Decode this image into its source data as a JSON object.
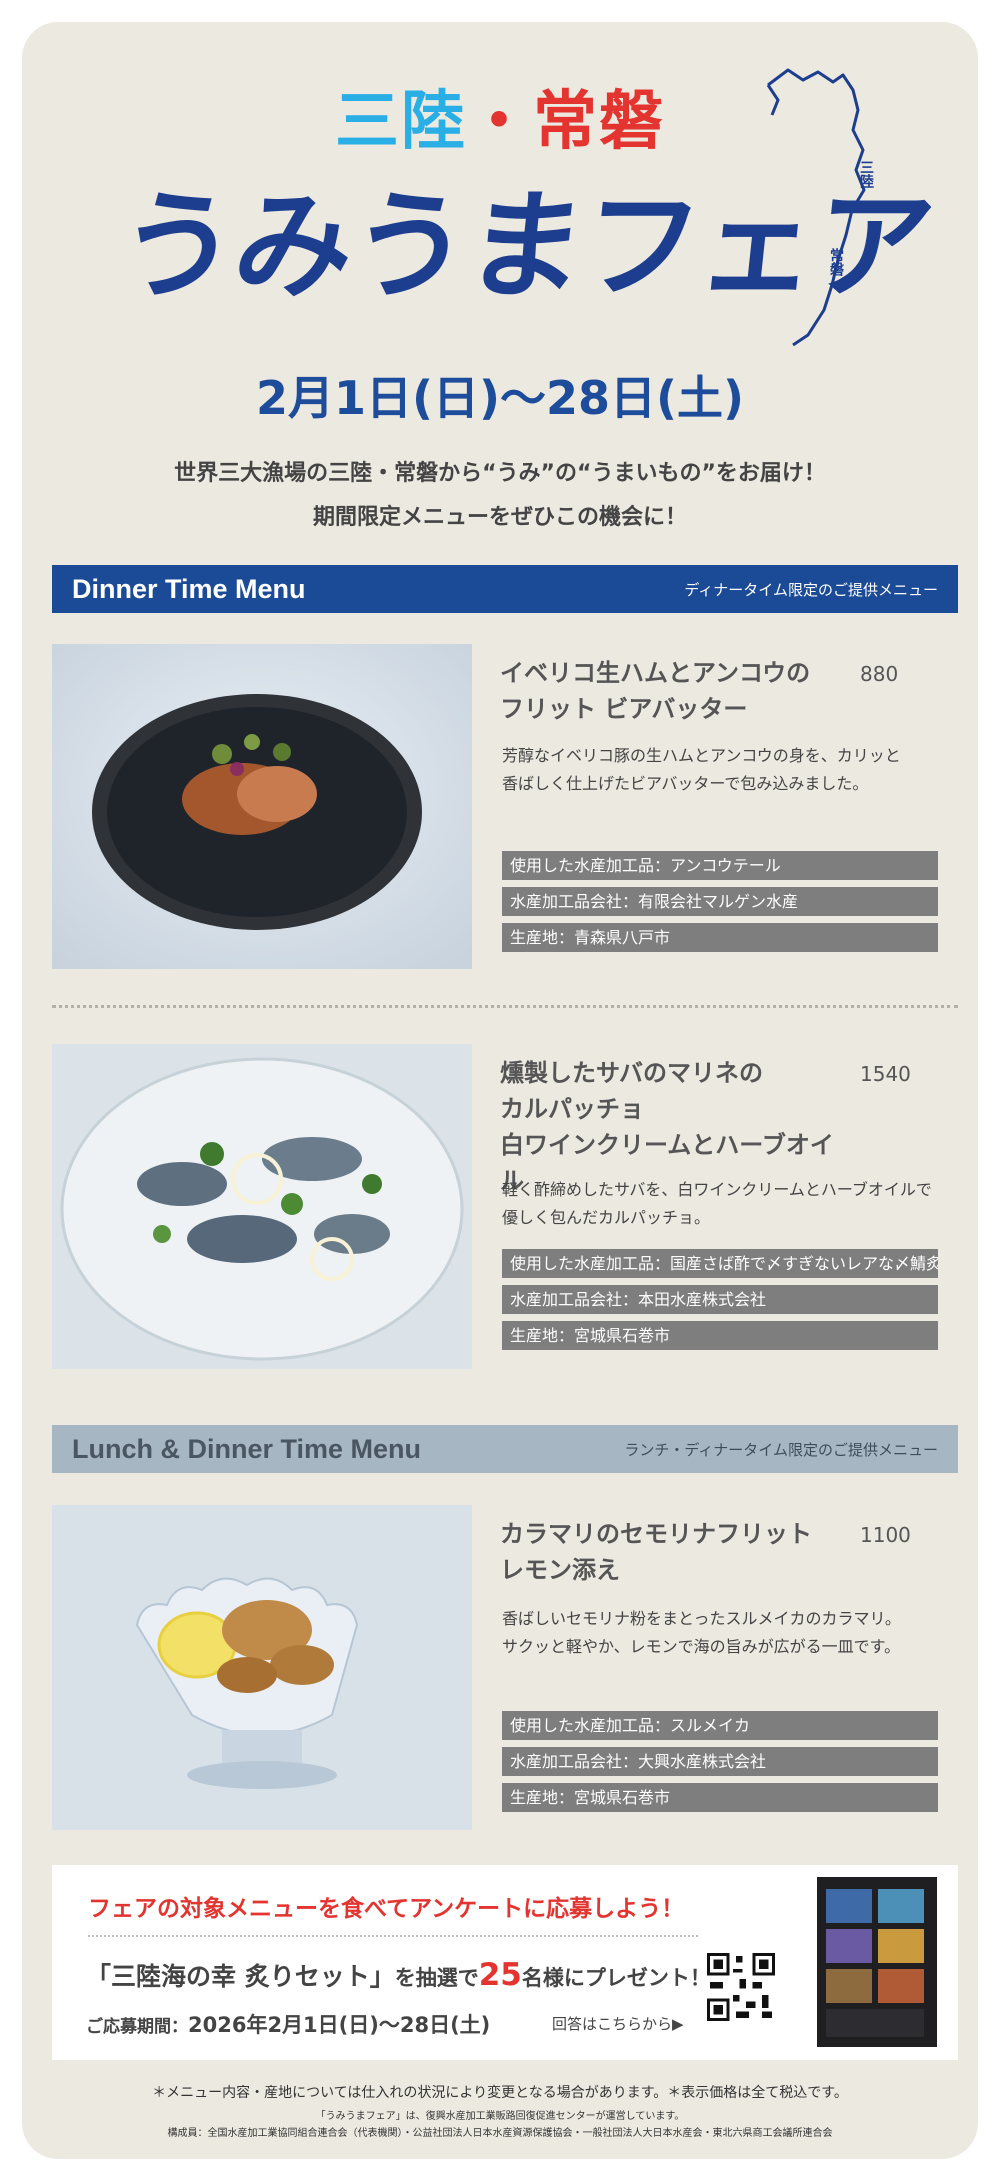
{
  "header": {
    "title_part1": "三陸",
    "title_dot": "・",
    "title_part2": "常磐",
    "logo_main": "うみうまフェア",
    "map_label_sanriku": "三陸",
    "map_label_joban": "常磐",
    "date_range": "2月1日(日)〜28日(土)",
    "intro_line1": "世界三大漁場の三陸・常磐から“うみ”の“うまいもの”をお届け！",
    "intro_line2": "期間限定メニューをぜひこの機会に！"
  },
  "sections": {
    "dinner": {
      "title": "Dinner Time Menu",
      "subtitle": "ディナータイム限定のご提供メニュー"
    },
    "lunch_dinner": {
      "title": "Lunch & Dinner Time Menu",
      "subtitle": "ランチ・ディナータイム限定のご提供メニュー"
    }
  },
  "items": [
    {
      "name_line1": "イベリコ生ハムとアンコウの",
      "name_line2": "フリット ビアバッター",
      "price": "880",
      "desc_line1": "芳醇なイベリコ豚の生ハムとアンコウの身を、カリッと",
      "desc_line2": "香ばしく仕上げたビアバッターで包み込みました。",
      "tags": [
        "使用した水産加工品：アンコウテール",
        "水産加工品会社：有限会社マルゲン水産",
        "生産地：青森県八戸市"
      ]
    },
    {
      "name_line1": "燻製したサバのマリネの",
      "name_line2": "カルパッチョ",
      "name_line3": "白ワインクリームとハーブオイル",
      "price": "1540",
      "desc_line1": "軽く酢締めしたサバを、白ワインクリームとハーブオイルで",
      "desc_line2": "優しく包んだカルパッチョ。",
      "tags": [
        "使用した水産加工品：国産さば酢で〆すぎないレアな〆鯖炙り",
        "水産加工品会社：本田水産株式会社",
        "生産地：宮城県石巻市"
      ]
    },
    {
      "name_line1": "カラマリのセモリナフリット",
      "name_line2": "レモン添え",
      "price": "1100",
      "desc_line1": "香ばしいセモリナ粉をまとったスルメイカのカラマリ。",
      "desc_line2": "サクッと軽やか、レモンで海の旨みが広がる一皿です。",
      "tags": [
        "使用した水産加工品：スルメイカ",
        "水産加工品会社：大興水産株式会社",
        "生産地：宮城県石巻市"
      ]
    }
  ],
  "campaign": {
    "headline": "フェアの対象メニューを食べてアンケートに応募しよう！",
    "prize_name": "「三陸海の幸 炙りセット」",
    "prize_mid": "を抽選で",
    "prize_count": "25",
    "prize_end": "名様にプレゼント！",
    "period_label": "ご応募期間：",
    "period_value": "2026年2月1日(日)〜28日(土)",
    "answer_link": "回答はこちらから▶"
  },
  "footer": {
    "note1": "＊メニュー内容・産地については仕入れの状況により変更となる場合があります。＊表示価格は全て税込です。",
    "note2": "「うみうまフェア」は、復興水産加工業販路回復促進センターが運営しています。",
    "note3": "構成員：全国水産加工業協同組合連合会（代表機関）・公益社団法人日本水産資源保護協会・一般社団法人大日本水産会・東北六県商工会議所連合会"
  },
  "colors": {
    "brand_blue": "#1b4a97",
    "accent_red": "#e3342f",
    "accent_cyan": "#29aee5",
    "tag_gray": "#7e7e7e",
    "bg": "#ece9e1"
  }
}
